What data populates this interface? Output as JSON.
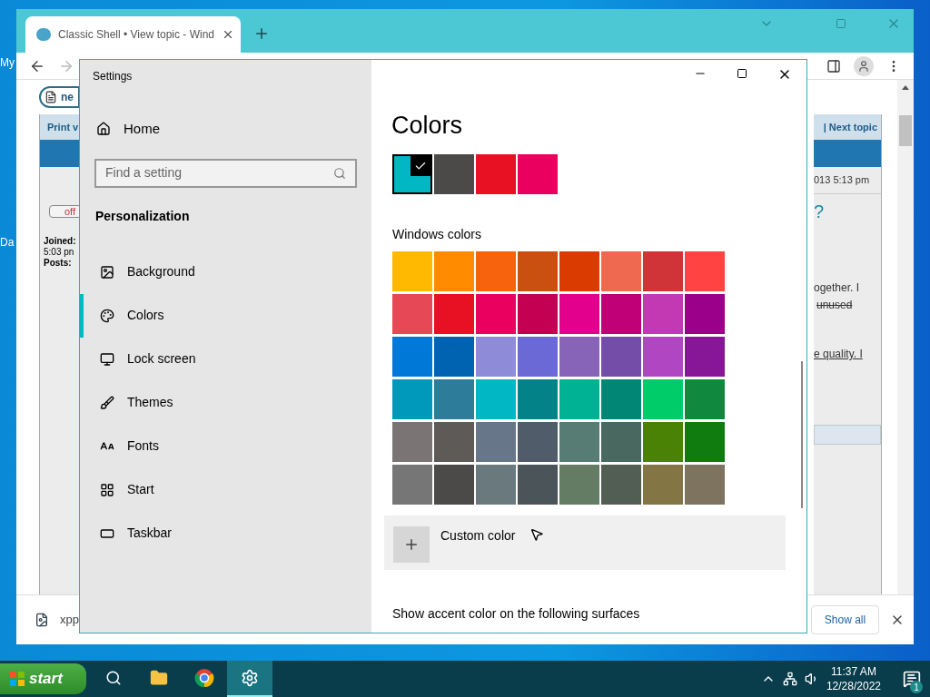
{
  "desktop": {
    "icons": [
      {
        "label": "My"
      },
      {
        "label": "Da"
      }
    ]
  },
  "browser": {
    "tab": {
      "title": "Classic Shell • View topic - Wind"
    },
    "page": {
      "left": {
        "button": "ne",
        "header": "Print v",
        "status": "off",
        "profile": [
          "Joined:",
          "5:03 pn",
          "Posts:"
        ]
      },
      "right": {
        "header": "| Next topic",
        "date": "013 5:13 pm",
        "title": "?",
        "lines": [
          {
            "text": "ogether. I",
            "kind": "plain"
          },
          {
            "text": "unused",
            "kind": "strike"
          },
          {
            "text": "e quality. I",
            "kind": "link"
          }
        ]
      }
    },
    "downloads": {
      "file": "xpp",
      "show_all": "Show all"
    }
  },
  "settings": {
    "title": "Settings",
    "home": "Home",
    "search": {
      "placeholder": "Find a setting"
    },
    "section": "Personalization",
    "nav": [
      {
        "label": "Background",
        "selected": false
      },
      {
        "label": "Colors",
        "selected": true
      },
      {
        "label": "Lock screen",
        "selected": false
      },
      {
        "label": "Themes",
        "selected": false
      },
      {
        "label": "Fonts",
        "selected": false
      },
      {
        "label": "Start",
        "selected": false
      },
      {
        "label": "Taskbar",
        "selected": false
      }
    ],
    "heading": "Colors",
    "recent_colors": [
      {
        "color": "#00b7c3",
        "selected": true
      },
      {
        "color": "#4c4a48",
        "selected": false
      },
      {
        "color": "#e81123",
        "selected": false
      },
      {
        "color": "#ea005e",
        "selected": false
      }
    ],
    "windows_colors_label": "Windows colors",
    "windows_colors": [
      {
        "color": "#ffb900",
        "selected": false
      },
      {
        "color": "#ff8c00",
        "selected": false
      },
      {
        "color": "#f7630c",
        "selected": false
      },
      {
        "color": "#ca5010",
        "selected": false
      },
      {
        "color": "#da3b01",
        "selected": false
      },
      {
        "color": "#ef6950",
        "selected": false
      },
      {
        "color": "#d13438",
        "selected": false
      },
      {
        "color": "#ff4343",
        "selected": false
      },
      {
        "color": "#e74856",
        "selected": false
      },
      {
        "color": "#e81123",
        "selected": false
      },
      {
        "color": "#ea005e",
        "selected": false
      },
      {
        "color": "#c30052",
        "selected": false
      },
      {
        "color": "#e3008c",
        "selected": false
      },
      {
        "color": "#bf0077",
        "selected": false
      },
      {
        "color": "#c239b3",
        "selected": false
      },
      {
        "color": "#9a0089",
        "selected": false
      },
      {
        "color": "#0078d7",
        "selected": false
      },
      {
        "color": "#0063b1",
        "selected": false
      },
      {
        "color": "#8e8cd8",
        "selected": false
      },
      {
        "color": "#6b69d6",
        "selected": false
      },
      {
        "color": "#8764b8",
        "selected": false
      },
      {
        "color": "#744da9",
        "selected": false
      },
      {
        "color": "#b146c2",
        "selected": false
      },
      {
        "color": "#881798",
        "selected": false
      },
      {
        "color": "#0099bc",
        "selected": false
      },
      {
        "color": "#2d7d9a",
        "selected": false
      },
      {
        "color": "#00b7c3",
        "selected": false
      },
      {
        "color": "#038387",
        "selected": false
      },
      {
        "color": "#00b294",
        "selected": false
      },
      {
        "color": "#018574",
        "selected": false
      },
      {
        "color": "#00cc6a",
        "selected": false
      },
      {
        "color": "#10893e",
        "selected": false
      },
      {
        "color": "#7a7574",
        "selected": false
      },
      {
        "color": "#5d5a58",
        "selected": false
      },
      {
        "color": "#68768a",
        "selected": false
      },
      {
        "color": "#515c6b",
        "selected": false
      },
      {
        "color": "#567c73",
        "selected": false
      },
      {
        "color": "#486860",
        "selected": false
      },
      {
        "color": "#498205",
        "selected": false
      },
      {
        "color": "#107c10",
        "selected": false
      },
      {
        "color": "#767676",
        "selected": false
      },
      {
        "color": "#4c4a48",
        "selected": false
      },
      {
        "color": "#69797e",
        "selected": false
      },
      {
        "color": "#4a5459",
        "selected": false
      },
      {
        "color": "#647c64",
        "selected": false
      },
      {
        "color": "#525e54",
        "selected": false
      },
      {
        "color": "#847545",
        "selected": false
      },
      {
        "color": "#7e735f",
        "selected": false
      }
    ],
    "custom_color": "Custom color",
    "surfaces_label": "Show accent color on the following surfaces"
  },
  "taskbar": {
    "start": "start",
    "apps": [
      {
        "selected": false
      },
      {
        "selected": false
      },
      {
        "selected": false
      },
      {
        "selected": true
      }
    ],
    "time": "11:37 AM",
    "date": "12/28/2022",
    "notifications": "1"
  }
}
